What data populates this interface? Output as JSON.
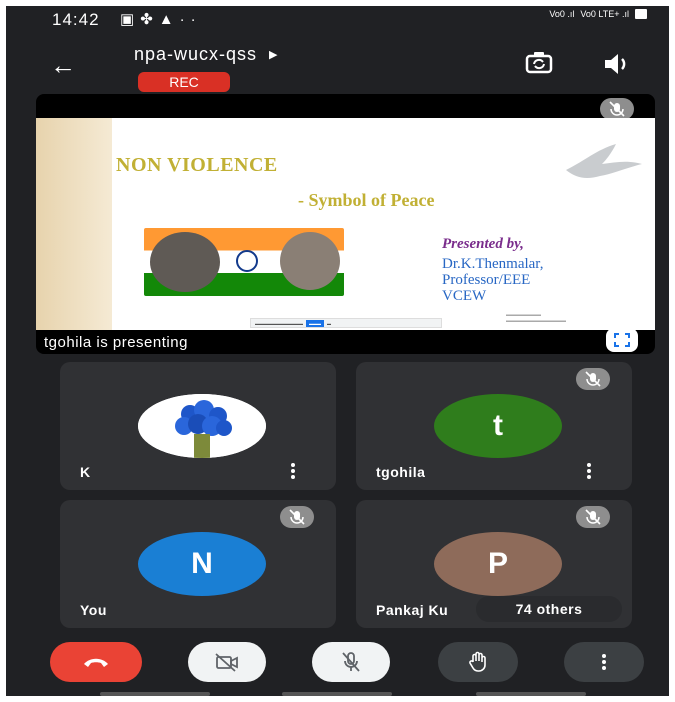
{
  "status_bar": {
    "time": "14:42",
    "icons": [
      "gallery-icon",
      "slack-icon",
      "warning-icon",
      "more-dots"
    ],
    "network_1": "VoLTE1",
    "network_2": "VoLTE2 4G+"
  },
  "header": {
    "meeting_code": "npa-wucx-qss",
    "rec_label": "REC"
  },
  "presentation": {
    "slide_title": "NON VIOLENCE",
    "slide_subtitle": "- Symbol of Peace",
    "presented_by": "Presented by,",
    "presenter_line1": "Dr.K.Thenmalar,",
    "presenter_line2": "Professor/EEE",
    "presenter_line3": "VCEW",
    "presenting_text": "tgohila is presenting"
  },
  "participants": [
    {
      "name": "K",
      "avatar": "flowers-image",
      "muted": false
    },
    {
      "name": "tgohila",
      "initial": "t",
      "muted": true
    },
    {
      "name": "You",
      "initial": "N",
      "muted": true
    },
    {
      "name": "Pankaj Ku",
      "initial": "P",
      "muted": true
    }
  ],
  "others_label": "74 others",
  "colors": {
    "background": "#202124",
    "tile": "#303134",
    "end_call": "#ea4335",
    "rec": "#d93025",
    "avatar_t": "#2f7d1c",
    "avatar_n": "#1a7fd4",
    "avatar_p": "#8e6b5a"
  }
}
